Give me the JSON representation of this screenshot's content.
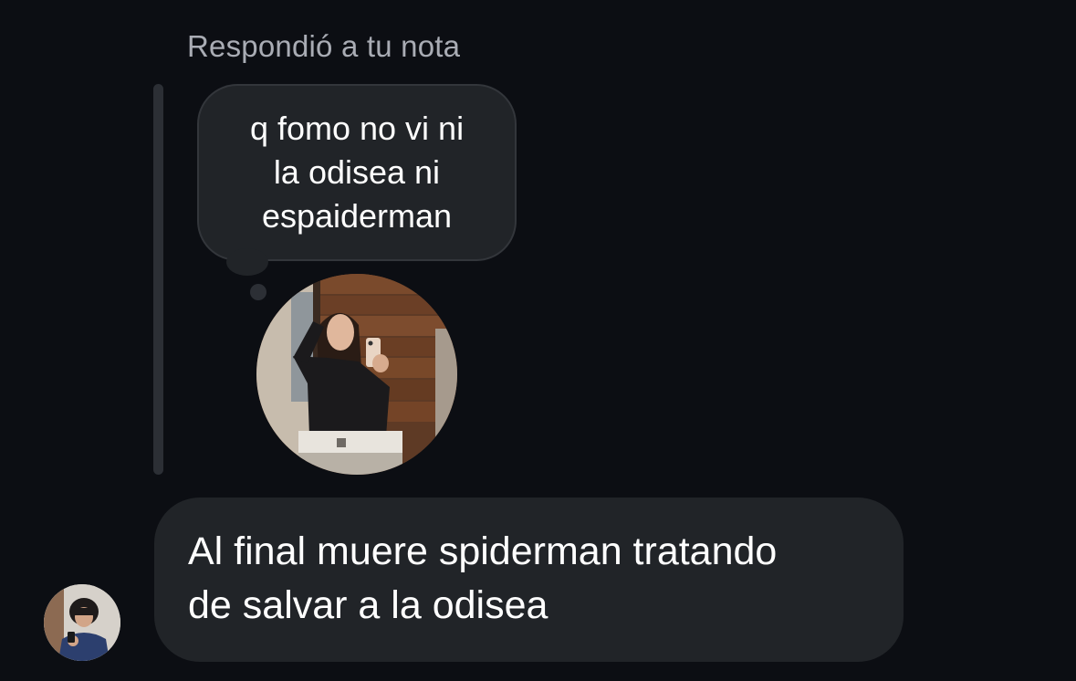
{
  "reply": {
    "label": "Respondió a tu nota"
  },
  "note": {
    "line1": "q fomo no vi ni",
    "line2": "la odisea ni",
    "line3": "espaiderman",
    "bubble_color": "#212428",
    "avatar_icon": "profile-photo-mirror-selfie"
  },
  "message": {
    "line1": "Al final muere spiderman tratando",
    "line2": "de salvar a la odisea",
    "bubble_color": "#212428"
  },
  "sender": {
    "avatar_icon": "profile-photo-avatar"
  },
  "theme": {
    "background": "#0c0e13",
    "secondary_text": "#a9acb4",
    "quote_bar": "#2c2f35"
  }
}
